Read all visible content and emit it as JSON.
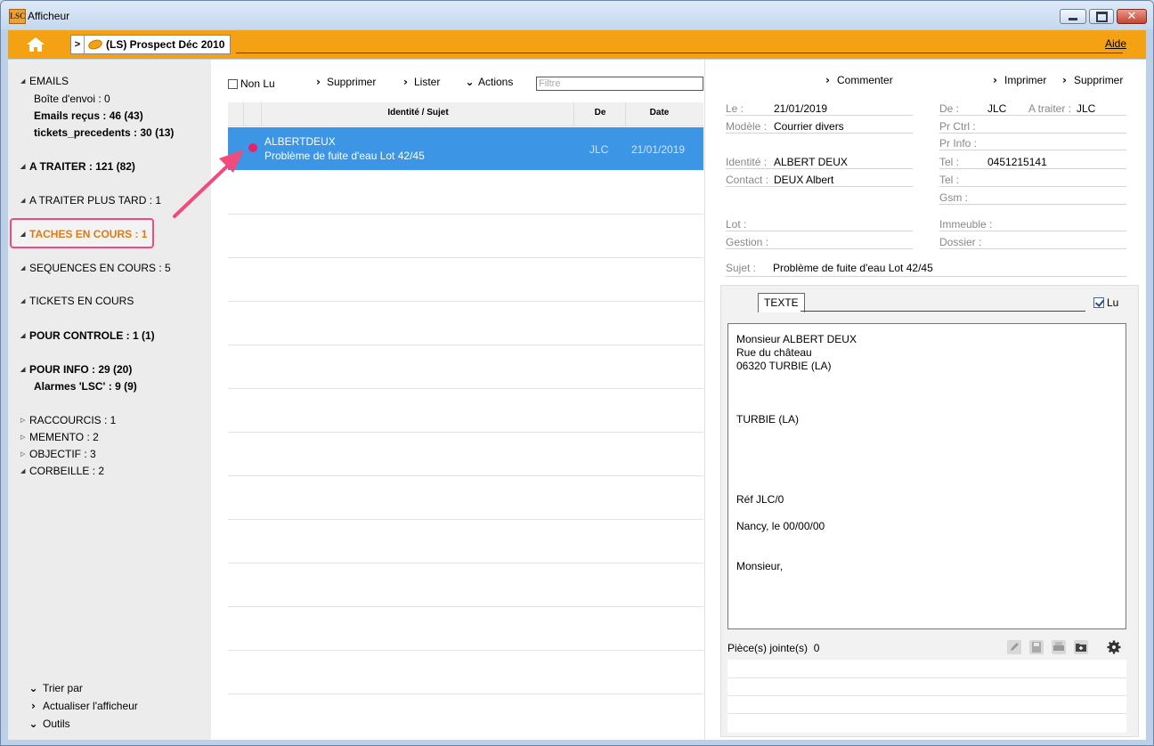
{
  "window": {
    "title": "Afficheur",
    "logo_text": "LSC"
  },
  "topbar": {
    "breadcrumb_chevron": ">",
    "breadcrumb_label": "(LS) Prospect Déc 2010",
    "help_label": "Aide"
  },
  "sidebar": {
    "emails": {
      "label": "EMAILS",
      "outbox": "Boîte d'envoi : 0",
      "received": "Emails reçus : 46 (43)",
      "previous_tickets": "tickets_precedents : 30 (13)"
    },
    "a_traiter": {
      "label": "A TRAITER : 121 (82)"
    },
    "a_traiter_plus_tard": {
      "label": "A TRAITER PLUS TARD : 1"
    },
    "taches_en_cours": {
      "label": "TACHES EN COURS : 1"
    },
    "sequences_en_cours": {
      "label": "SEQUENCES EN COURS : 5"
    },
    "tickets_en_cours": {
      "label": "TICKETS EN COURS"
    },
    "pour_controle": {
      "label": "POUR CONTROLE : 1 (1)"
    },
    "pour_info": {
      "label": "POUR INFO : 29 (20)",
      "alarmes": "Alarmes 'LSC' : 9 (9)"
    },
    "raccourcis": {
      "label": "RACCOURCIS : 1"
    },
    "memento": {
      "label": "MEMENTO : 2"
    },
    "objectif": {
      "label": "OBJECTIF : 3"
    },
    "corbeille": {
      "label": "CORBEILLE : 2"
    },
    "bottom": {
      "sort_label": "Trier par",
      "refresh_label": "Actualiser l'afficheur",
      "tools_label": "Outils"
    }
  },
  "list": {
    "toolbar": {
      "unread_label": "Non Lu",
      "delete_label": "Supprimer",
      "list_label": "Lister",
      "actions_label": "Actions",
      "filter_placeholder": "Filtre"
    },
    "columns": {
      "identity": "Identité / Sujet",
      "from": "De",
      "date": "Date"
    },
    "rows": [
      {
        "name": "ALBERTDEUX",
        "subject": "Problème de fuite d'eau Lot 42/45",
        "from": "JLC",
        "date": "21/01/2019",
        "selected": true,
        "unread_dot_color": "#e8206a"
      }
    ]
  },
  "detail": {
    "toolbar": {
      "comment_label": "Commenter",
      "print_label": "Imprimer",
      "delete_label": "Supprimer"
    },
    "fields": {
      "le_label": "Le :",
      "le_value": "21/01/2019",
      "modele_label": "Modèle :",
      "modele_value": "Courrier divers",
      "identite_label": "Identité :",
      "identite_value": "ALBERT DEUX",
      "contact_label": "Contact :",
      "contact_value": "DEUX Albert",
      "lot_label": "Lot :",
      "gestion_label": "Gestion :",
      "sujet_label": "Sujet :",
      "sujet_value": "Problème de fuite d'eau Lot 42/45",
      "de_label": "De :",
      "de_value": "JLC",
      "a_traiter_label": "A traiter :",
      "a_traiter_value": "JLC",
      "pr_ctrl_label": "Pr Ctrl :",
      "pr_info_label": "Pr Info :",
      "tel1_label": "Tel :",
      "tel1_value": "0451215141",
      "tel2_label": "Tel :",
      "gsm_label": "Gsm :",
      "immeuble_label": "Immeuble :",
      "dossier_label": "Dossier :"
    },
    "message": {
      "tab_label": "TEXTE",
      "read_label": "Lu",
      "read_checked": true,
      "letter_lines": [
        "Monsieur ALBERT DEUX",
        "Rue du château",
        "06320 TURBIE (LA)",
        "TURBIE (LA)",
        "Réf  JLC/0",
        "Nancy, le 00/00/00",
        "Monsieur,"
      ],
      "attachments_label": "Pièce(s) jointe(s)",
      "attachments_count": "0"
    }
  },
  "colors": {
    "accent_orange": "#f4a214",
    "selection_blue": "#3d95e6",
    "highlight_pink": "#f14b7d",
    "active_section": "#e07a12"
  }
}
